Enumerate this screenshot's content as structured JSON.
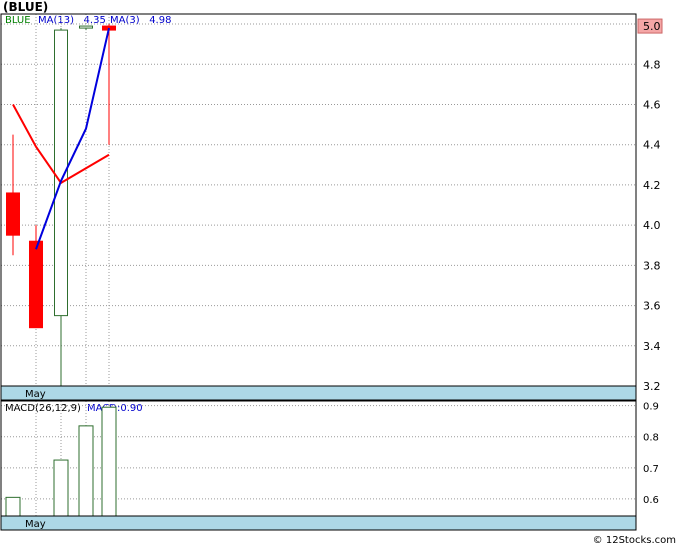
{
  "header": {
    "symbol": "(BLUE)",
    "legend_symbol": "BLUE",
    "ma13_label": "MA(13)",
    "ma13_value": "4.35",
    "ma3_label": "MA(3)",
    "ma3_value": "4.98",
    "macd_label": "MACD(26,12,9)",
    "macd_value_label": "MACD:0.90"
  },
  "last_price_tag": "5.0",
  "footer": "© 12Stocks.com",
  "colors": {
    "up": "#2e6e2e",
    "down": "#ff0000",
    "ma13": "#ff0000",
    "ma3": "#0000dd",
    "axis_band": "#add8e6",
    "grid": "#999999",
    "legend_symbol": "#008000",
    "legend_ma": "#0000cc"
  },
  "chart_data": [
    {
      "type": "candlestick",
      "title": "(BLUE)",
      "xlabel": "May",
      "ylim": [
        3.2,
        5.05
      ],
      "yticks": [
        "3.2",
        "3.4",
        "3.6",
        "3.8",
        "4.0",
        "4.2",
        "4.4",
        "4.6",
        "4.8",
        "5.0"
      ],
      "candles": [
        {
          "open": 4.16,
          "high": 4.45,
          "low": 3.85,
          "close": 3.95
        },
        {
          "open": 3.92,
          "high": 4.0,
          "low": 3.49,
          "close": 3.49
        },
        {
          "open": 3.55,
          "high": 4.98,
          "low": 3.2,
          "close": 4.97
        },
        {
          "open": 4.98,
          "high": 4.99,
          "low": 4.97,
          "close": 4.99
        },
        {
          "open": 4.99,
          "high": 5.0,
          "low": 4.4,
          "close": 4.97
        }
      ],
      "series": [
        {
          "name": "MA(13)",
          "values": [
            4.6,
            4.39,
            4.21,
            null,
            4.35
          ]
        },
        {
          "name": "MA(3)",
          "values": [
            null,
            3.88,
            4.22,
            4.48,
            4.98
          ]
        }
      ]
    },
    {
      "type": "bar",
      "title": "MACD(26,12,9)",
      "xlabel": "May",
      "ylim": [
        0.545,
        0.915
      ],
      "yticks": [
        "0.6",
        "0.7",
        "0.8",
        "0.9"
      ],
      "values": [
        0.605,
        null,
        0.725,
        0.835,
        0.895
      ]
    }
  ]
}
